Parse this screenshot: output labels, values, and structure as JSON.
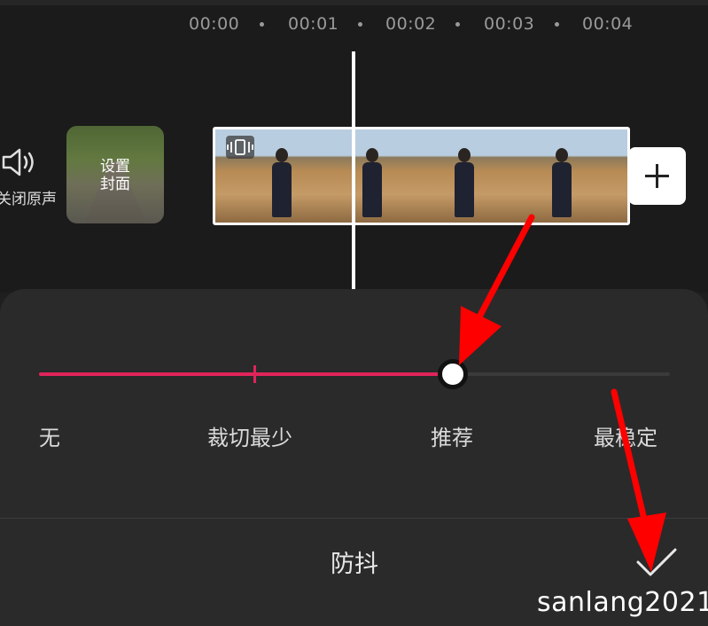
{
  "timeline": {
    "ticks": [
      "00:00",
      "00:01",
      "00:02",
      "00:03",
      "00:04"
    ]
  },
  "track": {
    "mute_label": "关闭原声",
    "cover_label_line1": "设置",
    "cover_label_line2": "封面",
    "add_icon": "plus-icon",
    "clip_badge_icon": "stabilize-icon"
  },
  "stabilize": {
    "levels": [
      "无",
      "裁切最少",
      "推荐",
      "最稳定"
    ],
    "selected_level": "推荐",
    "selected_fraction": 0.66,
    "accent_color": "#e0245a",
    "title": "防抖",
    "confirm_icon": "checkmark-icon"
  },
  "watermark": "sanlang2021",
  "annotation_color": "#ff0000"
}
